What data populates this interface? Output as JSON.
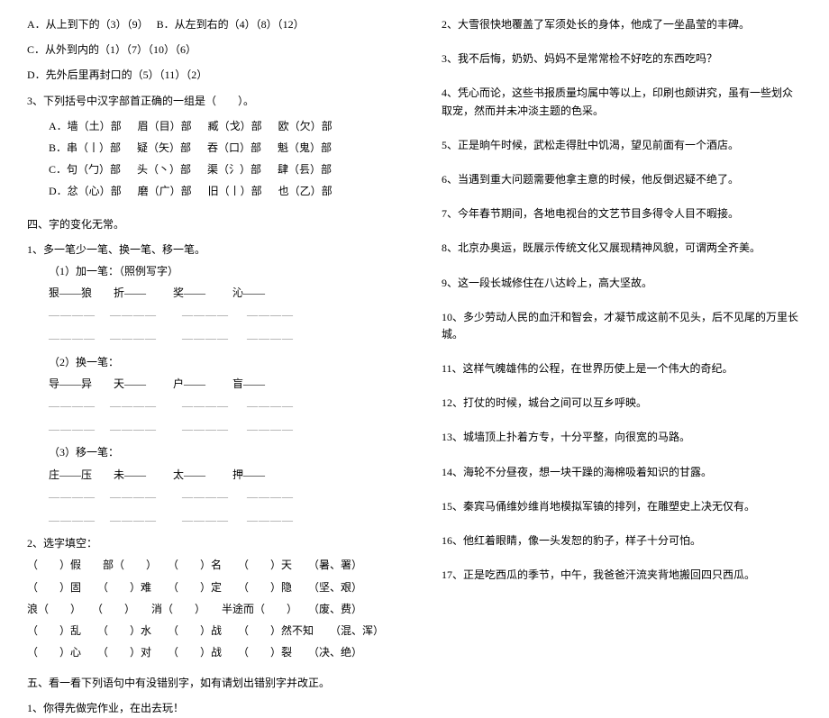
{
  "left": {
    "l1": "A．从上到下的（3）（9）   B．从左到右的（4）（8）（12）",
    "l2": "C．从外到内的（1）（7）（10）（6）",
    "l3": "D．先外后里再封口的（5）（11）（2）",
    "l4": "3、下列括号中汉字部首正确的一组是（        ）。",
    "l5a": "A．墙（土）部      眉（目）部      臧（戈）部      欧（欠）部",
    "l5b": "B．串（丨）部      疑（矢）部      吞（口）部      魁（鬼）部",
    "l5c": "C．句（勹）部      头（丶）部      渠（氵）部      肆（镸）部",
    "l5d": "D．忿（心）部      磨（广）部      旧（丨）部      也（乙）部",
    "section4": "四、字的变化无常。",
    "q1": "1、多一笔少一笔、换一笔、移一笔。",
    "q1a": "（1）加一笔：（照例写字）",
    "ex1": "狠——狼        折——          奖——          沁——",
    "blanks1": "————    ————       ————     ————",
    "blanks2": "————    ————       ————     ————",
    "q1b": "（2）换一笔：",
    "ex2": "导——异        天——          户——          盲——",
    "q1c": "（3）移一笔：",
    "ex3": "庄——压        未——          太——          押——",
    "q2": "2、选字填空：",
    "q2a": "（　　）假　　部（　　）　　（　　）名　　（　　）天　　（暑、署）",
    "q2b": "（　　）固　　（　　）难　　（　　）定　　（　　）隐　　（坚、艰）",
    "q2c": "浪（　　）　　（　　）　　消（　　）　　半途而（　　）　　（废、费）",
    "q2d": "（　　）乱　　（　　）水　　（　　）战　　（　　）然不知　　（混、浑）",
    "q2e": "（　　）心　　（　　）对　　（　　）战　　（　　）裂　　（决、绝）",
    "section5": "五、看一看下列语句中有没错别字，如有请划出错别字并改正。",
    "s5_1": "1、你得先做完作业，在出去玩！"
  },
  "right": {
    "r2": "2、大雪很快地覆盖了军须处长的身体，他成了一坐晶莹的丰碑。",
    "r3": "3、我不后悔，奶奶、妈妈不是常常检不好吃的东西吃吗？",
    "r4": "4、凭心而论，这些书报质量均属中等以上，印刷也颇讲究，虽有一些划众取宠，然而并未冲淡主题的色采。",
    "r5": "5、正是晌午时候，武松走得肚中饥渴，望见前面有一个酒店。",
    "r6": "6、当遇到重大问题需要他拿主意的时候，他反倒迟疑不绝了。",
    "r7": "7、今年春节期间，各地电视台的文艺节目多得令人目不暇接。",
    "r8": "8、北京办奥运，既展示传统文化又展现精神风貌，可谓两全齐美。",
    "r9": "9、这一段长城修住在八达岭上，高大坚故。",
    "r10": "10、多少劳动人民的血汗和智会，才凝节成这前不见头，后不见尾的万里长城。",
    "r11": "11、这样气魄雄伟的公程，在世界历使上是一个伟大的奇纪。",
    "r12": "12、打仗的时候，城台之间可以互乡呼映。",
    "r13": "13、城墙顶上扑着方专，十分平整，向很宽的马路。",
    "r14": "14、海轮不分昼夜，想一块干躁的海棉吸着知识的甘露。",
    "r15": "15、秦宾马俑维妙维肖地模拟军镇的排列，在雕塑史上决无仅有。",
    "r16": "16、他红着眼睛，像一头发恕的豹子，样子十分可怕。",
    "r17": "17、正是吃西瓜的季节，中午，我爸爸汗流夹背地搬回四只西瓜。"
  }
}
